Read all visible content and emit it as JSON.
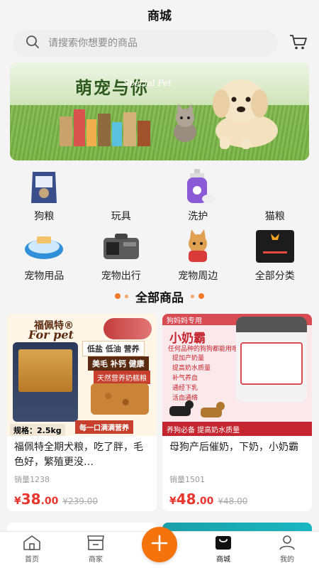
{
  "header": {
    "title": "商城"
  },
  "search": {
    "placeholder": "请搜索你想要的商品"
  },
  "banner": {
    "slogan": "萌宠与你",
    "script": "Special Pet"
  },
  "categories": [
    {
      "label": "狗粮",
      "icon": "dog-food-bag-icon"
    },
    {
      "label": "玩具",
      "icon": "toy-icon"
    },
    {
      "label": "洗护",
      "icon": "shampoo-icon"
    },
    {
      "label": "猫粮",
      "icon": "cat-food-icon"
    },
    {
      "label": "宠物用品",
      "icon": "pet-bowl-icon"
    },
    {
      "label": "宠物出行",
      "icon": "pet-carrier-icon"
    },
    {
      "label": "宠物周边",
      "icon": "dog-costume-icon"
    },
    {
      "label": "全部分类",
      "icon": "all-categories-icon"
    }
  ],
  "section": {
    "title": "全部商品"
  },
  "products": [
    {
      "name": "福佩特全期犬粮，吃了胖，毛色好，繁殖更没…",
      "sales": "销量1238",
      "currency": "¥",
      "price_int": "38",
      "price_dec": ".00",
      "price_old": "¥239.00",
      "image": {
        "brand": "福佩特®",
        "brand_en": "For pet",
        "tag1": "低盐  低油  营养",
        "tag2": "美毛  补钙  健康",
        "tag3": "天然营养奶糕粮",
        "spec": "规格：2.5kg",
        "bottom": "每一口满满营养"
      }
    },
    {
      "name": "母狗产后催奶，下奶，小奶霸",
      "sales": "销量1501",
      "currency": "¥",
      "price_int": "48",
      "price_dec": ".00",
      "price_old": "¥48.00",
      "image": {
        "hdr": "狗妈妈专用",
        "big": "小奶霸",
        "sub": "任何品种的狗狗都能用哦",
        "list": [
          "提加产奶量",
          "提高奶水质量",
          "补气养血",
          "通经下乳",
          "活血通络"
        ],
        "strip": "养狗必备  提高奶水质量"
      }
    }
  ],
  "tabbar": [
    {
      "label": "首页",
      "icon": "home-icon"
    },
    {
      "label": "商家",
      "icon": "store-icon"
    },
    {
      "label": "",
      "icon": "plus-icon"
    },
    {
      "label": "商城",
      "icon": "mall-icon"
    },
    {
      "label": "我的",
      "icon": "user-icon"
    }
  ],
  "colors": {
    "accent": "#f5730c",
    "price": "#e8352e",
    "section_dot": "#f27a2a"
  }
}
